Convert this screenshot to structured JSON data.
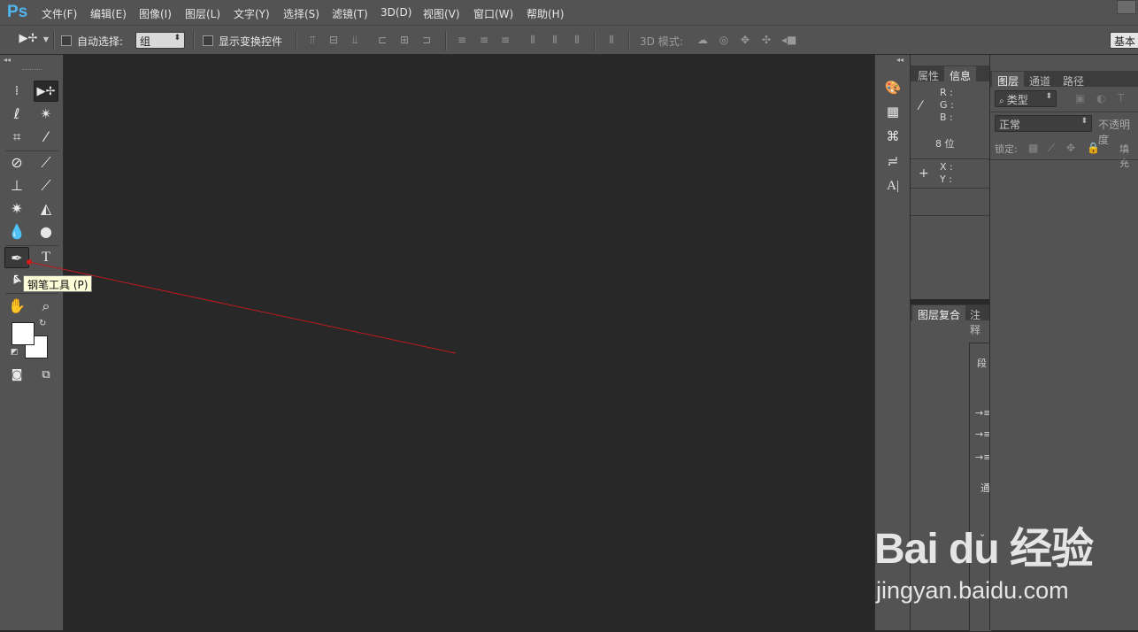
{
  "app": {
    "logo": "Ps"
  },
  "menu": [
    "文件(F)",
    "编辑(E)",
    "图像(I)",
    "图层(L)",
    "文字(Y)",
    "选择(S)",
    "滤镜(T)",
    "3D(D)",
    "视图(V)",
    "窗口(W)",
    "帮助(H)"
  ],
  "options": {
    "auto_select_label": "自动选择:",
    "auto_select_value": "组",
    "show_transform_label": "显示变换控件",
    "mode3d_label": "3D 模式:",
    "workspace": "基本"
  },
  "tooltip": "钢笔工具 (P)",
  "info_panel": {
    "tabs": [
      "属性",
      "信息"
    ],
    "active_tab": "信息",
    "r_label": "R :",
    "g_label": "G :",
    "b_label": "B :",
    "bit_depth": "8 位",
    "x_label": "X :",
    "y_label": "Y :",
    "lower_tabs": [
      "图层复合",
      "注释"
    ],
    "floating_labels": [
      "段",
      "通"
    ]
  },
  "layers_panel": {
    "tabs": [
      "图层",
      "通道",
      "路径"
    ],
    "active_tab": "图层",
    "filter_kind": "类型",
    "blend_mode": "正常",
    "opacity_label": "不透明度",
    "lock_label": "锁定:",
    "fill_label": "填充"
  },
  "watermark": {
    "logo_text": "Bai du 经验",
    "url": "jingyan.baidu.com"
  },
  "colors": {
    "panel_bg": "#535353",
    "canvas_bg": "#282828",
    "annotation_line": "#c0191c",
    "tooltip_bg": "#fdfdd8"
  }
}
